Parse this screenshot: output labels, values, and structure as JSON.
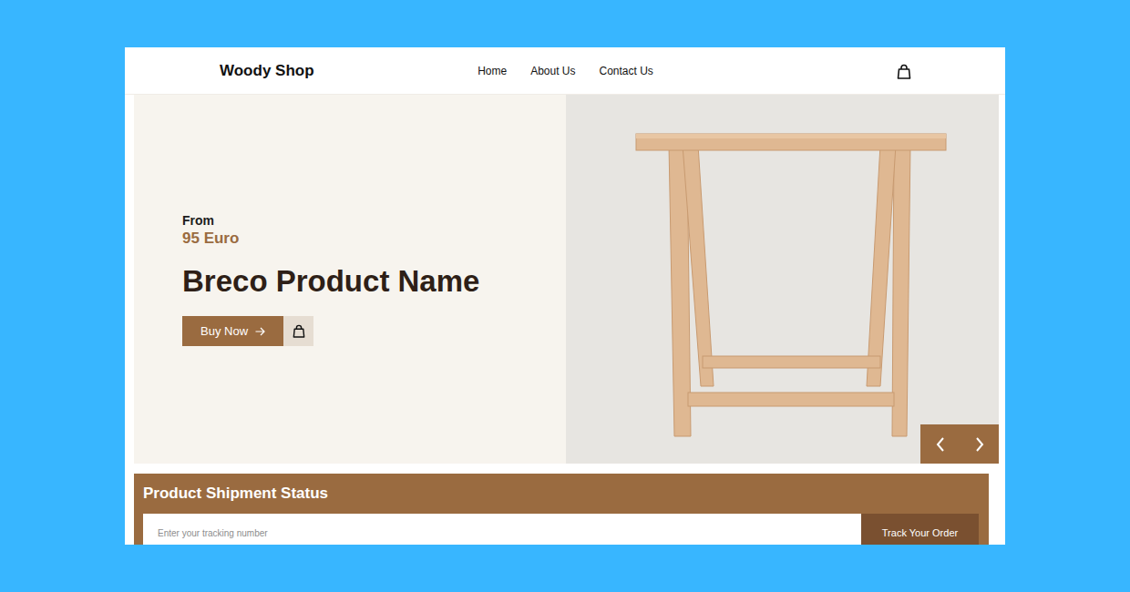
{
  "brand": "Woody Shop",
  "nav": [
    {
      "label": "Home"
    },
    {
      "label": "About Us"
    },
    {
      "label": "Contact Us"
    }
  ],
  "hero": {
    "from": "From",
    "price": "95 Euro",
    "title": "Breco Product Name",
    "buy": "Buy Now"
  },
  "shipment": {
    "title": "Product Shipment Status",
    "placeholder": "Enter your tracking number",
    "button": "Track Your Order"
  }
}
